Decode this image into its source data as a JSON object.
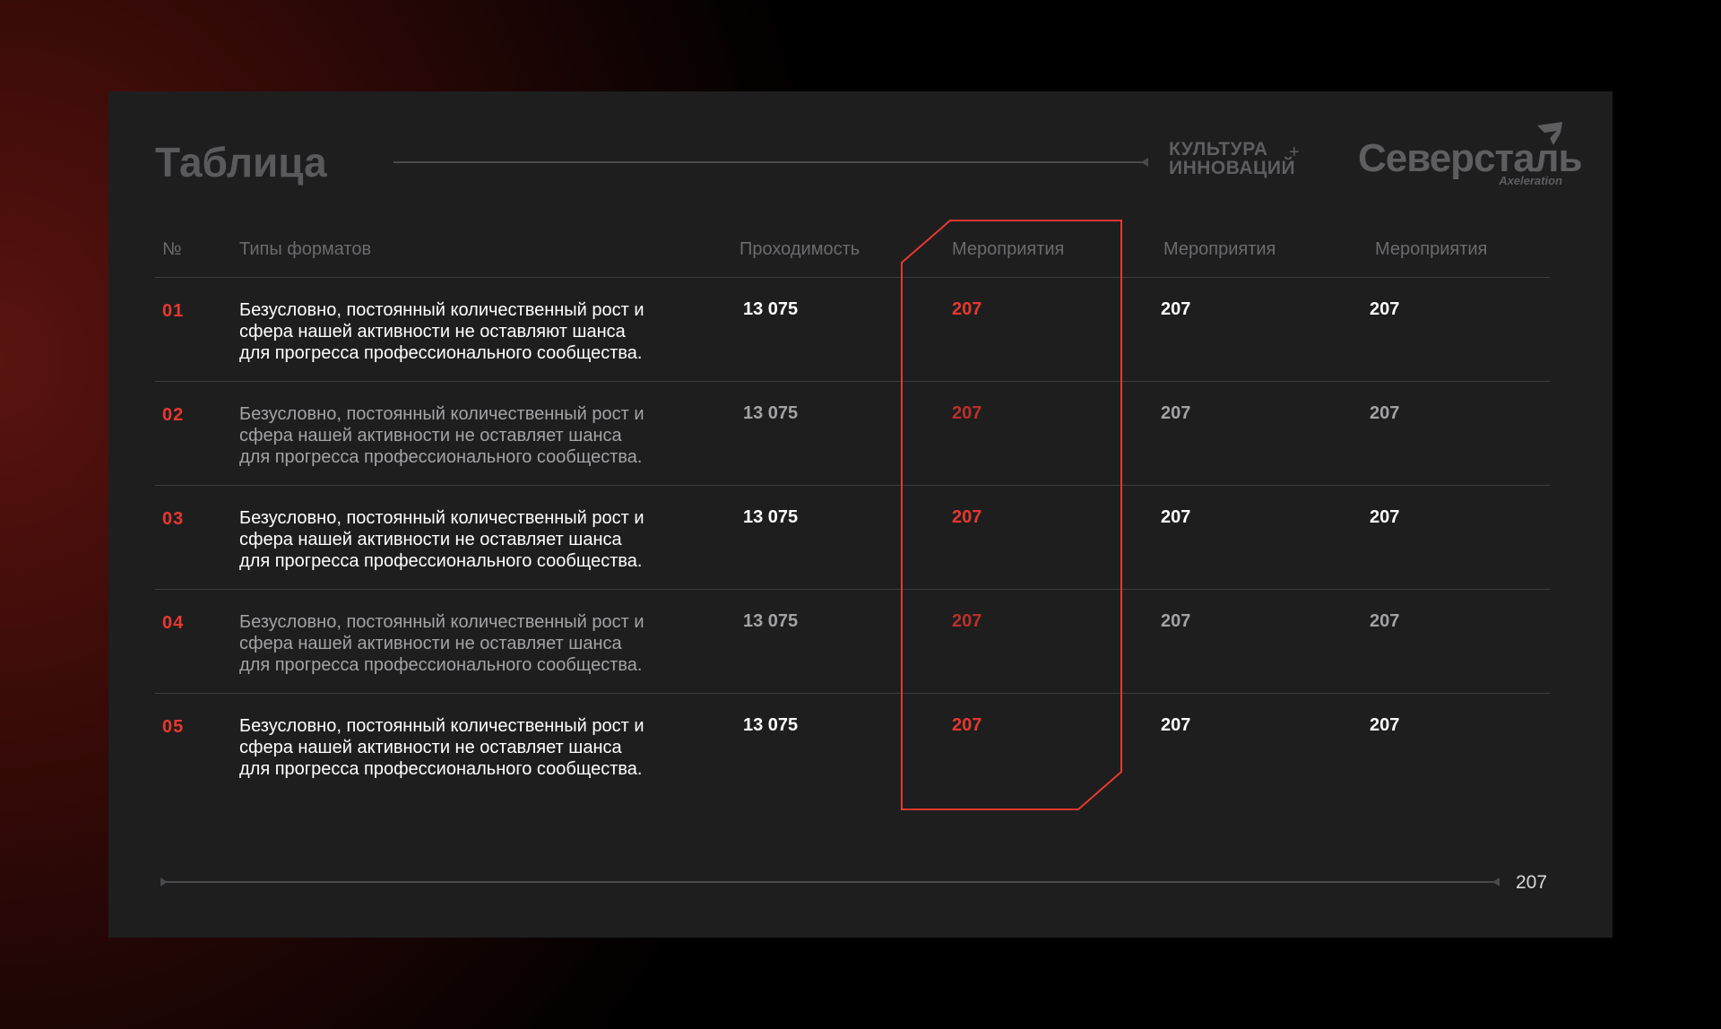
{
  "header": {
    "title": "Таблица",
    "culture_line1": "КУЛЬТУРА",
    "culture_line2": "ИННОВАЦИЙ",
    "culture_plus": "+",
    "logo_word": "Северсталь",
    "logo_sub": "Axeleration"
  },
  "table": {
    "columns": [
      "№",
      "Типы форматов",
      "Проходимость",
      "Мероприятия",
      "Мероприятия",
      "Мероприятия"
    ],
    "rows": [
      {
        "num": "01",
        "desc_1": "Безусловно, постоянный количественный рост и",
        "desc_2": "сфера нашей активности не оставляют шанса",
        "desc_3": "для прогресса профессионального сообщества.",
        "pass": "13 075",
        "ev1": "207",
        "ev2": "207",
        "ev3": "207"
      },
      {
        "num": "02",
        "desc_1": "Безусловно, постоянный количественный рост и",
        "desc_2": "сфера нашей активности не оставляет шанса",
        "desc_3": "для прогресса профессионального сообщества.",
        "pass": "13 075",
        "ev1": "207",
        "ev2": "207",
        "ev3": "207"
      },
      {
        "num": "03",
        "desc_1": "Безусловно, постоянный количественный рост и",
        "desc_2": "сфера нашей активности не оставляет шанса",
        "desc_3": "для прогресса профессионального сообщества.",
        "pass": "13 075",
        "ev1": "207",
        "ev2": "207",
        "ev3": "207"
      },
      {
        "num": "04",
        "desc_1": "Безусловно, постоянный количественный рост и",
        "desc_2": "сфера нашей активности не оставляет шанса",
        "desc_3": "для прогресса профессионального сообщества.",
        "pass": "13 075",
        "ev1": "207",
        "ev2": "207",
        "ev3": "207"
      },
      {
        "num": "05",
        "desc_1": "Безусловно, постоянный количественный рост и",
        "desc_2": "сфера нашей активности не оставляет шанса",
        "desc_3": "для прогресса профессионального сообщества.",
        "pass": "13 075",
        "ev1": "207",
        "ev2": "207",
        "ev3": "207"
      }
    ]
  },
  "footer": {
    "page_number": "207"
  },
  "colors": {
    "accent": "#e8382e",
    "panel": "#1e1e1f",
    "muted": "#6b6b6d"
  }
}
